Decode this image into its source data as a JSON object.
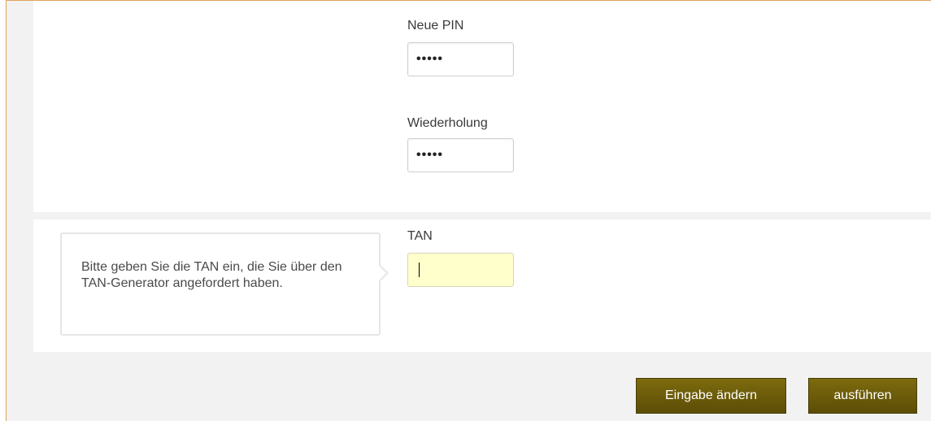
{
  "form": {
    "new_pin": {
      "label": "Neue PIN",
      "value": "•••••"
    },
    "repeat_pin": {
      "label": "Wiederholung",
      "value": "•••••"
    },
    "tan": {
      "label": "TAN",
      "value": "",
      "hint": "Bitte geben Sie die TAN ein, die Sie über den TAN-Generator angefordert haben.",
      "highlight_color": "#ffffcc"
    }
  },
  "actions": {
    "change_label": "Eingabe ändern",
    "execute_label": "ausführen",
    "button_color": "#6b5a0a"
  }
}
